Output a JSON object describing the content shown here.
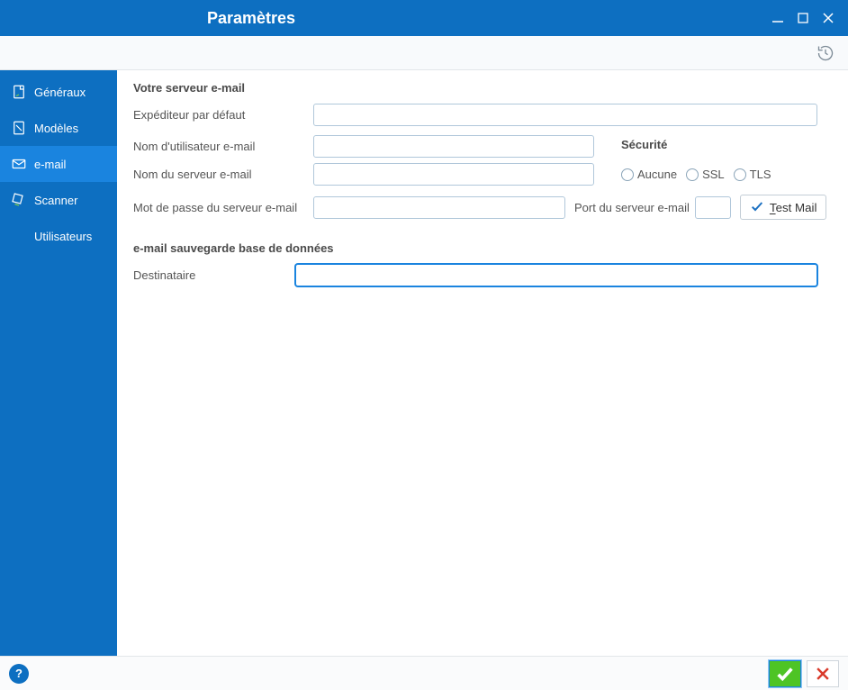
{
  "window": {
    "title": "Paramètres"
  },
  "sidebar": {
    "items": [
      {
        "label": "Généraux"
      },
      {
        "label": "Modèles"
      },
      {
        "label": "e-mail"
      },
      {
        "label": "Scanner"
      },
      {
        "label": "Utilisateurs"
      }
    ]
  },
  "content": {
    "server_section_title": "Votre serveur e-mail",
    "default_sender_label": "Expéditeur par défaut",
    "default_sender_value": "",
    "username_label": "Nom d'utilisateur e-mail",
    "username_value": "",
    "servername_label": "Nom du serveur e-mail",
    "servername_value": "",
    "password_label": "Mot de passe du serveur e-mail",
    "password_value": "",
    "port_label": "Port du serveur e-mail",
    "port_value": "",
    "security_title": "Sécurité",
    "security_options": {
      "none": "Aucune",
      "ssl": "SSL",
      "tls": "TLS"
    },
    "test_mail_label_prefix": "T",
    "test_mail_label_rest": "est Mail",
    "backup_section_title": "e-mail sauvegarde base de données",
    "recipient_label": "Destinataire",
    "recipient_value": ""
  },
  "footer": {
    "help_glyph": "?"
  }
}
